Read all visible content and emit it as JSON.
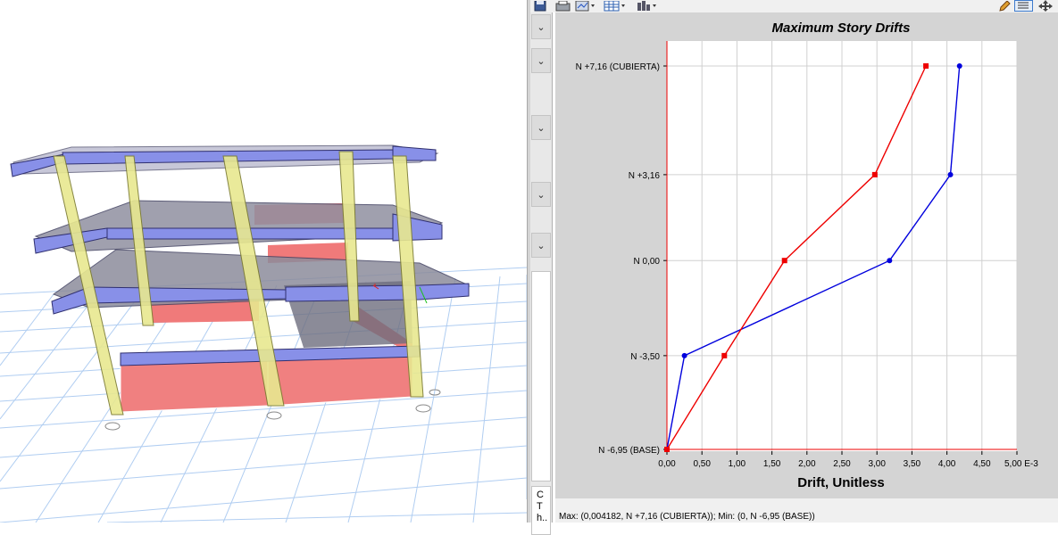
{
  "toolbar": {
    "icons": [
      "save-icon",
      "print-icon",
      "chart-options-icon",
      "table-icon",
      "export-icon",
      "pencil-icon",
      "list-icon",
      "move-icon"
    ]
  },
  "left_panel": {
    "dropdowns": [
      "⌄",
      "⌄",
      "⌄",
      "⌄",
      "⌄"
    ],
    "bottom_label": [
      "C",
      "T",
      "h.."
    ]
  },
  "chart_data": {
    "type": "line",
    "title": "Maximum Story Drifts",
    "xlabel": "Drift, Unitless",
    "ylabel": "",
    "x_unit_suffix": "E-3",
    "xlim": [
      0,
      5
    ],
    "x_ticks": [
      0,
      0.5,
      1,
      1.5,
      2,
      2.5,
      3,
      3.5,
      4,
      4.5,
      5
    ],
    "x_tick_labels": [
      "0,00",
      "0,50",
      "1,00",
      "1,50",
      "2,00",
      "2,50",
      "3,00",
      "3,50",
      "4,00",
      "4,50",
      "5,00 E-3"
    ],
    "y_axis_stories": [
      {
        "label": "N +7,16 (CUBIERTA)",
        "elev": 7.16
      },
      {
        "label": "N +3,16",
        "elev": 3.16
      },
      {
        "label": "N 0,00",
        "elev": 0.0
      },
      {
        "label": "N -3,50",
        "elev": -3.5
      },
      {
        "label": "N -6,95 (BASE)",
        "elev": -6.95
      }
    ],
    "ylim": [
      -6.95,
      7.16
    ],
    "grid": true,
    "series": [
      {
        "color": "#0000dd",
        "marker": "circle",
        "x": [
          0.0,
          0.25,
          3.18,
          4.05,
          4.18
        ],
        "y": [
          -6.95,
          -3.5,
          0.0,
          3.16,
          7.16
        ]
      },
      {
        "color": "#ee0000",
        "marker": "square",
        "x": [
          0.0,
          0.82,
          1.68,
          2.97,
          3.7
        ],
        "y": [
          -6.95,
          -3.5,
          0.0,
          3.16,
          7.16
        ]
      }
    ]
  },
  "status": {
    "text": "Max: (0,004182, N +7,16 (CUBIERTA));   Min: (0, N -6,95 (BASE))"
  }
}
